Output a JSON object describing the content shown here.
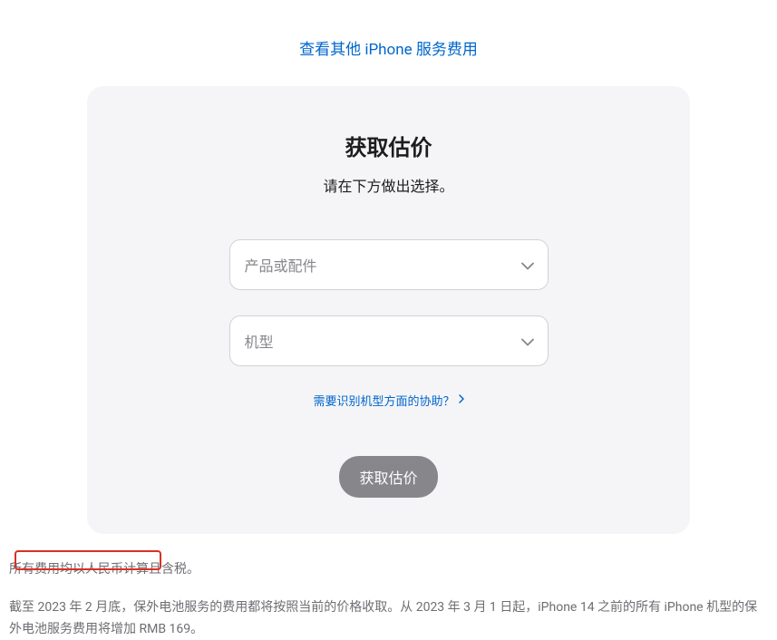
{
  "topLink": {
    "label": "查看其他 iPhone 服务费用"
  },
  "card": {
    "title": "获取估价",
    "subtitle": "请在下方做出选择。",
    "select1": {
      "placeholder": "产品或配件"
    },
    "select2": {
      "placeholder": "机型"
    },
    "helpLink": {
      "label": "需要识别机型方面的协助？"
    },
    "button": {
      "label": "获取估价"
    }
  },
  "footer": {
    "para1": "所有费用均以人民币计算且含税。",
    "para2": "截至 2023 年 2 月底，保外电池服务的费用都将按照当前的价格收取。从 2023 年 3 月 1 日起，iPhone 14 之前的所有 iPhone 机型的保外电池服务费用将增加 RMB 169。"
  }
}
